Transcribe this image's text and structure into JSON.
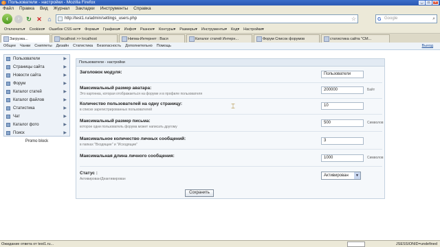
{
  "window": {
    "title": "Пользователи - настройки - Mozilla Firefox"
  },
  "menubar": [
    "Файл",
    "Правка",
    "Вид",
    "Журнал",
    "Закладки",
    "Инструменты",
    "Справка"
  ],
  "navbar": {
    "url": "http://test1.ru/admin/settings_users.php",
    "search_placeholder": "Google"
  },
  "toolbar": [
    "Отключить▾",
    "Cookies▾",
    "Ошибок CSS нет▾",
    "Формы▾",
    "Графика▾",
    "Инфо▾",
    "Разное▾",
    "Контуры▾",
    "Размеры▾",
    "Инструменты▾",
    "Код▾",
    "Настройки▾"
  ],
  "tabs": [
    "Загрузка...",
    "localhost >> localhost",
    "Нигма-Интернет : Вася",
    "Каталог статей Интерн...",
    "Форум Список форумов",
    "статистика сайта \"СМ..."
  ],
  "appmenu": {
    "items": [
      "Общее",
      "Чанки",
      "Сниппеты",
      "Дизайн",
      "Статистика",
      "Безопасность",
      "Дополнительно",
      "Помощь"
    ],
    "logout": "Выход"
  },
  "sidebar": {
    "items": [
      {
        "label": "Пользователи",
        "has_arrow": true
      },
      {
        "label": "Страницы сайта",
        "has_arrow": true
      },
      {
        "label": "Новости сайта",
        "has_arrow": true
      },
      {
        "label": "Форум",
        "has_arrow": true
      },
      {
        "label": "Каталог статей",
        "has_arrow": true
      },
      {
        "label": "Каталог файлов",
        "has_arrow": true
      },
      {
        "label": "Статистика",
        "has_arrow": true
      },
      {
        "label": "Чат",
        "has_arrow": true
      },
      {
        "label": "Каталог фото",
        "has_arrow": true
      },
      {
        "label": "Поиск",
        "has_arrow": true
      }
    ],
    "promo": "Promo block"
  },
  "content": {
    "header": "Пользователи - настройки",
    "rows": [
      {
        "label": "Заголовок модуля:",
        "desc": "",
        "value": "Пользователи",
        "unit": ""
      },
      {
        "label": "Максимальный размер аватара:",
        "desc": "Это картинка, которая отображаеться на форуме и в профиле пользователя",
        "value": "200000",
        "unit": "Байт"
      },
      {
        "label": "Количество пользователей на одну страницу:",
        "desc": "в списке зарегистрированных пользователей",
        "value": "10",
        "unit": ""
      },
      {
        "label": "Максимальный размер письма:",
        "desc": "которое одни пользователь форума может написать другому",
        "value": "500",
        "unit": "Символов"
      },
      {
        "label": "Максимальное количество личных сообщений:",
        "desc": "в папках \"Входящие\" и \"Исходящие\"",
        "value": "3",
        "unit": ""
      },
      {
        "label": "Максимальная длина личного сообщения:",
        "desc": "",
        "value": "1000",
        "unit": "Символов"
      }
    ],
    "status": {
      "label": "Статус :",
      "desc": "Активирован/Деактивирован",
      "selected": "Активирован"
    },
    "save_label": "Сохранить"
  },
  "statusbar": {
    "text": "Ожидание ответа от test1.ru...",
    "session": "JSESSIONID=undefined"
  }
}
